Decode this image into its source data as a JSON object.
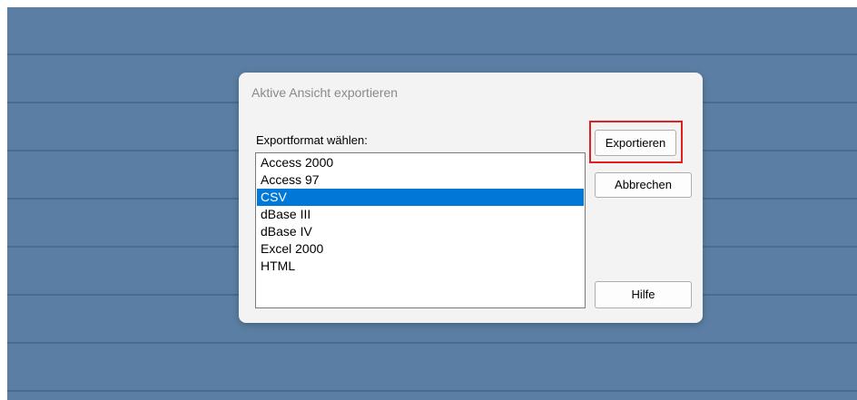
{
  "dialog": {
    "title": "Aktive Ansicht exportieren",
    "list_label": "Exportformat wählen:",
    "formats": [
      "Access 2000",
      "Access 97",
      "CSV",
      "dBase III",
      "dBase IV",
      "Excel 2000",
      "HTML"
    ],
    "selected_format": "CSV",
    "buttons": {
      "export": "Exportieren",
      "cancel": "Abbrechen",
      "help": "Hilfe"
    }
  },
  "colors": {
    "desktop_background": "#5b7fa4",
    "selection": "#0078d7",
    "highlight_frame": "#e02020"
  }
}
